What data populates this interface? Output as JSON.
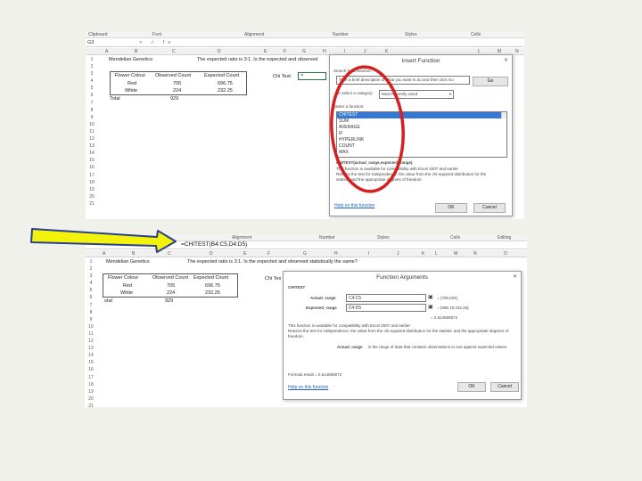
{
  "top": {
    "ribbon": [
      "Clipboard",
      "Font",
      "Alignment",
      "Number",
      "Styles",
      "Cells"
    ],
    "namebox": "G3",
    "fx_icons": "× ✓ fx",
    "columns": [
      "A",
      "B",
      "C",
      "D",
      "E",
      "F",
      "G",
      "H",
      "I",
      "J",
      "K",
      "L",
      "M",
      "N"
    ],
    "rows": [
      "1",
      "2",
      "3",
      "4",
      "5",
      "6",
      "7",
      "8",
      "9",
      "10",
      "11",
      "12",
      "13",
      "14",
      "15",
      "16",
      "17",
      "18",
      "19",
      "20",
      "21"
    ],
    "a1": "Mendelian Genetics:",
    "expected_text": "The expected ratio is 3:1. Is the expected and observed",
    "headers": [
      "Flower Colour",
      "Observed Count",
      "Expected Count"
    ],
    "rows_data": [
      [
        "Red",
        "705",
        "696.75"
      ],
      [
        "White",
        "224",
        "232.25"
      ]
    ],
    "total_label": "Total",
    "total_value": "929",
    "chi_label": "Chi Test:",
    "chi_cell": "=",
    "dialog": {
      "title": "Insert Function",
      "search_label": "Search for a function:",
      "search_value": "Type a brief description of what you want to do and then click Go",
      "go": "Go",
      "category_label": "Or select a category:",
      "category_value": "Most Recently Used",
      "select_label": "Select a function:",
      "functions": [
        "CHITEST",
        "SUM",
        "AVERAGE",
        "IF",
        "HYPERLINK",
        "COUNT",
        "MAX"
      ],
      "syntax": "CHITEST(actual_range,expected_range)",
      "desc1": "This function is available for compatibility with Excel 2007 and earlier.",
      "desc2": "Returns the test for independence: the value from the chi-squared distribution for the",
      "desc3": "statistic and the appropriate degrees of freedom.",
      "help": "Help on this function",
      "ok": "OK",
      "cancel": "Cancel"
    }
  },
  "bottom": {
    "ribbon": [
      "Alignment",
      "Number",
      "Styles",
      "Cells",
      "Editing"
    ],
    "formula": "=CHITEST(B4:C5,D4:D5)",
    "columns": [
      "A",
      "B",
      "C",
      "D",
      "E",
      "F",
      "G",
      "H",
      "I",
      "J",
      "K",
      "L",
      "M",
      "N",
      "O"
    ],
    "rows": [
      "1",
      "2",
      "3",
      "4",
      "5",
      "6",
      "7",
      "8",
      "9",
      "10",
      "11",
      "12",
      "13",
      "14",
      "15",
      "16",
      "17",
      "18",
      "19",
      "20",
      "21"
    ],
    "a1": "Mendelian Genetics",
    "expected_text": "The expected ratio is 3:1. Is the expected and observed statistically the same?",
    "headers": [
      "Flower Colour",
      "Observed Count",
      "Expected Count"
    ],
    "rows_data": [
      [
        "Red",
        "705",
        "696.75"
      ],
      [
        "White",
        "224",
        "232.25"
      ]
    ],
    "total_label": "otal",
    "total_value": "929",
    "chi_label": "Chi Tes",
    "dialog": {
      "title": "Function Arguments",
      "fn": "CHITEST",
      "actual_label": "Actual_range",
      "actual_value": "C4:C5",
      "actual_result": "= {705;224}",
      "expected_label": "Expected_range",
      "expected_value": "D4:D5",
      "expected_result": "= {696.75;232.25}",
      "result_line": "= 0.514569072",
      "desc1": "This function is available for compatibility with Excel 2007 and earlier.",
      "desc2": "Returns the test for independence: the value from the chi-squared distribution for the statistic and the appropriate degrees of",
      "desc3": "freedom.",
      "arg_label": "Actual_range",
      "arg_desc": "is the range of data that contains observations to test against expected values.",
      "formula_result": "Formula result = 0.514569072",
      "help": "Help on this function",
      "ok": "OK",
      "cancel": "Cancel"
    }
  },
  "annotations": {
    "circle_color": "#d42020",
    "arrow_fill": "#f2f20a",
    "arrow_stroke": "#2a3f8f"
  }
}
